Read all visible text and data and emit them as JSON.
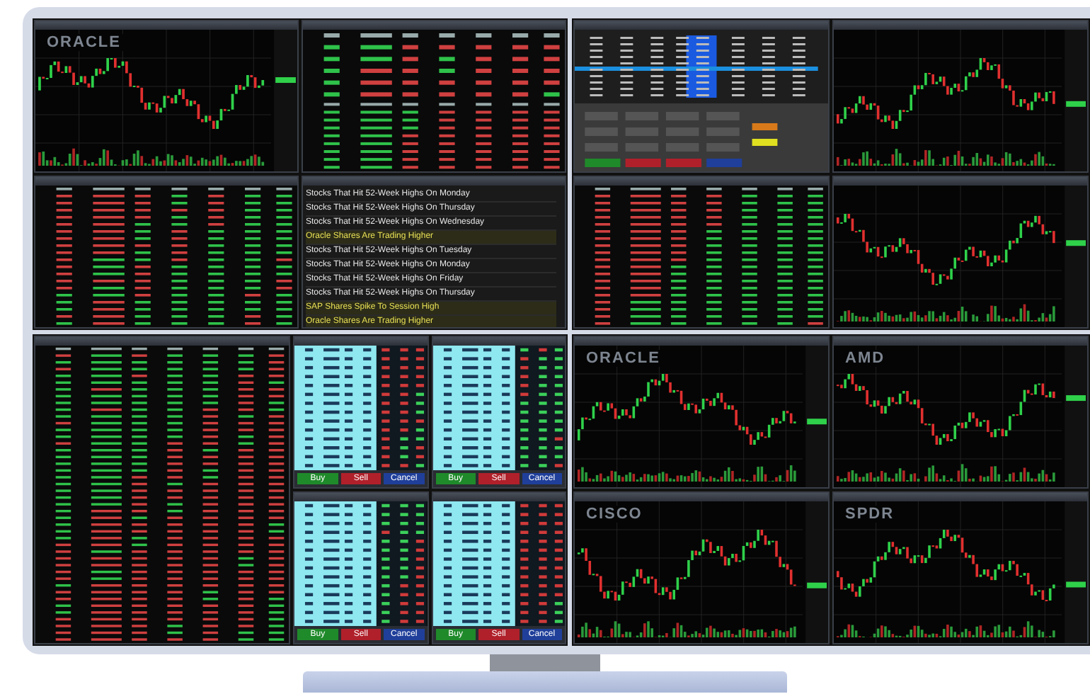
{
  "monitors": [
    {
      "kind": "quad",
      "panels": [
        {
          "kind": "chart",
          "logo": "ORACLE"
        },
        {
          "kind": "positions"
        },
        {
          "kind": "watchlist"
        },
        {
          "kind": "news",
          "items": [
            {
              "headline": "Stocks That Hit 52-Week Highs On Monday",
              "highlighted": false
            },
            {
              "headline": "Stocks That Hit 52-Week Highs On Thursday",
              "highlighted": false
            },
            {
              "headline": "Stocks That Hit 52-Week Highs On Wednesday",
              "highlighted": false
            },
            {
              "headline": "Oracle Shares Are Trading Higher",
              "highlighted": true
            },
            {
              "headline": "Stocks That Hit 52-Week Highs On Tuesday",
              "highlighted": false
            },
            {
              "headline": "Stocks That Hit 52-Week Highs On Monday",
              "highlighted": false
            },
            {
              "headline": "Stocks That Hit 52-Week Highs On Friday",
              "highlighted": false
            },
            {
              "headline": "Stocks That Hit 52-Week Highs On Thursday",
              "highlighted": false
            },
            {
              "headline": "SAP Shares Spike To Session High",
              "highlighted": true
            },
            {
              "headline": "Oracle Shares Are Trading Higher",
              "highlighted": true
            }
          ]
        }
      ]
    },
    {
      "kind": "quad",
      "panels": [
        {
          "kind": "ladder"
        },
        {
          "kind": "chart"
        },
        {
          "kind": "watchlist"
        },
        {
          "kind": "chart"
        }
      ]
    },
    {
      "kind": "side",
      "panels": [
        {
          "kind": "watchlist"
        },
        {
          "kind": "ticket",
          "buttons": [
            "Buy",
            "Sell",
            "Cancel"
          ]
        },
        {
          "kind": "ticket",
          "buttons": [
            "Buy",
            "Sell",
            "Cancel"
          ]
        },
        {
          "kind": "ticket",
          "buttons": [
            "Buy",
            "Sell",
            "Cancel"
          ]
        },
        {
          "kind": "ticket",
          "buttons": [
            "Buy",
            "Sell",
            "Cancel"
          ]
        }
      ]
    },
    {
      "kind": "quad",
      "panels": [
        {
          "kind": "chart",
          "logo": "ORACLE"
        },
        {
          "kind": "chart",
          "logo": "AMD"
        },
        {
          "kind": "chart",
          "logo": "CISCO"
        },
        {
          "kind": "chart",
          "logo": "SPDR"
        }
      ]
    }
  ]
}
